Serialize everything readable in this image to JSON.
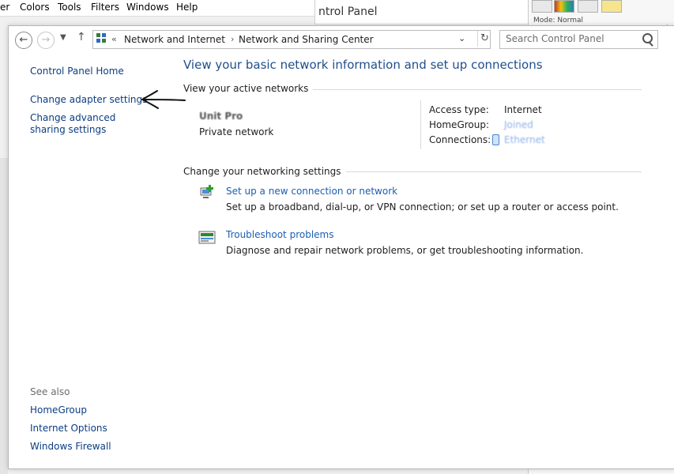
{
  "background": {
    "menubar": [
      "er",
      "Colors",
      "Tools",
      "Filters",
      "Windows",
      "Help"
    ],
    "control_panel_title": "ntrol Panel",
    "mode_label": "Mode: Normal"
  },
  "nav": {
    "breadcrumb_prefix": "«",
    "breadcrumbs": [
      "Network and Internet",
      "Network and Sharing Center"
    ],
    "search_placeholder": "Search Control Panel"
  },
  "left_pane": {
    "home": "Control Panel Home",
    "links": [
      "Change adapter settings",
      "Change advanced sharing settings"
    ],
    "see_also_label": "See also",
    "see_also": [
      "HomeGroup",
      "Internet Options",
      "Windows Firewall"
    ]
  },
  "content": {
    "title": "View your basic network information and set up connections",
    "active_networks_heading": "View your active networks",
    "network_name": "Unit Pro",
    "network_type": "Private network",
    "access_type_label": "Access type:",
    "access_type_value": "Internet",
    "homegroup_label": "HomeGroup:",
    "homegroup_value": "Joined",
    "connections_label": "Connections:",
    "connections_value": "Ethernet",
    "change_settings_heading": "Change your networking settings",
    "tasks": [
      {
        "title": "Set up a new connection or network",
        "description": "Set up a broadband, dial-up, or VPN connection; or set up a router or access point."
      },
      {
        "title": "Troubleshoot problems",
        "description": "Diagnose and repair network problems, or get troubleshooting information."
      }
    ]
  }
}
